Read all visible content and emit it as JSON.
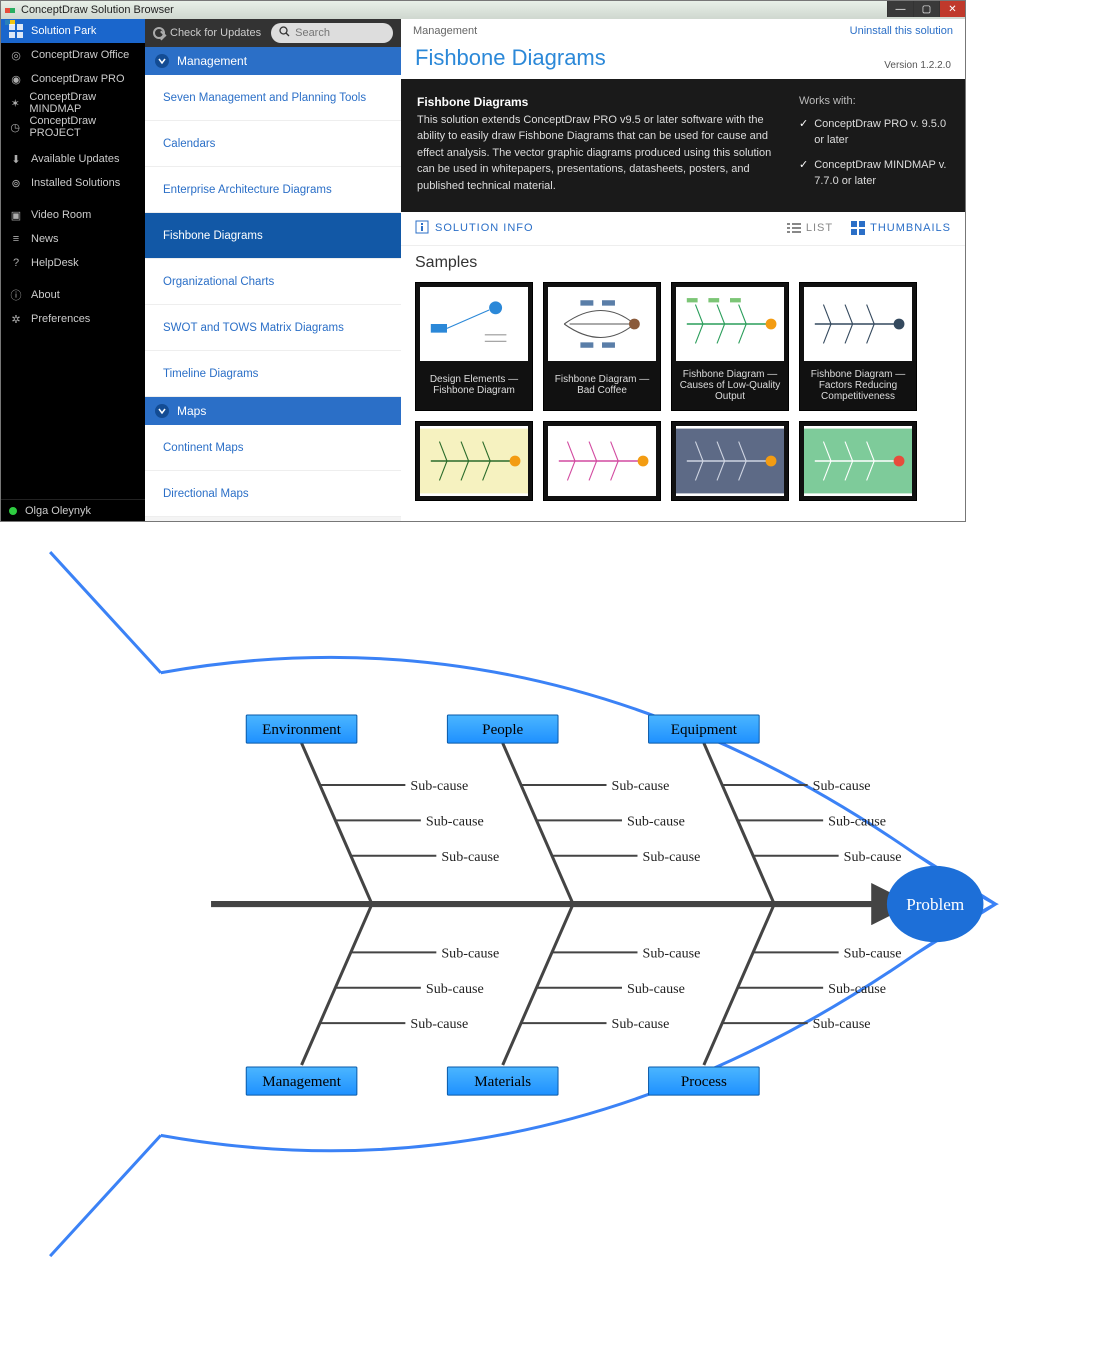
{
  "window": {
    "title": "ConceptDraw Solution Browser"
  },
  "sidebar": {
    "items": [
      "Solution Park",
      "ConceptDraw Office",
      "ConceptDraw PRO",
      "ConceptDraw MINDMAP",
      "ConceptDraw PROJECT"
    ],
    "mid": [
      "Available Updates",
      "Installed Solutions"
    ],
    "mid2": [
      "Video Room",
      "News",
      "HelpDesk"
    ],
    "bot": [
      "About",
      "Preferences"
    ],
    "user": "Olga Oleynyk"
  },
  "navtop": {
    "updates": "Check for Updates",
    "search_ph": "Search"
  },
  "navgroups": [
    {
      "title": "Management",
      "items": [
        "Seven Management and Planning Tools",
        "Calendars",
        "Enterprise Architecture Diagrams",
        "Fishbone Diagrams",
        "Organizational Charts",
        "SWOT and TOWS Matrix Diagrams",
        "Timeline Diagrams"
      ],
      "selected": "Fishbone Diagrams"
    },
    {
      "title": "Maps",
      "items": [
        "Continent Maps",
        "Directional Maps"
      ]
    }
  ],
  "content": {
    "breadcrumb": "Management",
    "uninstall": "Uninstall this solution",
    "title": "Fishbone Diagrams",
    "version": "Version 1.2.2.0",
    "hero_title": "Fishbone Diagrams",
    "hero_body": "This solution extends ConceptDraw PRO v9.5 or later software with the ability to easily draw Fishbone Diagrams that can be used for cause and effect analysis.\nThe vector graphic diagrams produced using this solution can be used in whitepapers, presentations, datasheets, posters, and published technical material.",
    "works_hdr": "Works with:",
    "works": [
      "ConceptDraw PRO v. 9.5.0 or later",
      "ConceptDraw MINDMAP v. 7.7.0 or later"
    ],
    "solution_info": "SOLUTION INFO",
    "view_list": "LIST",
    "view_thumb": "THUMBNAILS",
    "samples_hdr": "Samples",
    "cards": [
      "Design Elements — Fishbone Diagram",
      "Fishbone Diagram — Bad Coffee",
      "Fishbone Diagram — Causes of Low-Quality Output",
      "Fishbone Diagram — Factors Reducing Competitiveness"
    ]
  },
  "fishbone": {
    "problem": "Problem",
    "top": [
      "Environment",
      "People",
      "Equipment"
    ],
    "bottom": [
      "Management",
      "Materials",
      "Process"
    ],
    "sub": "Sub-cause"
  }
}
